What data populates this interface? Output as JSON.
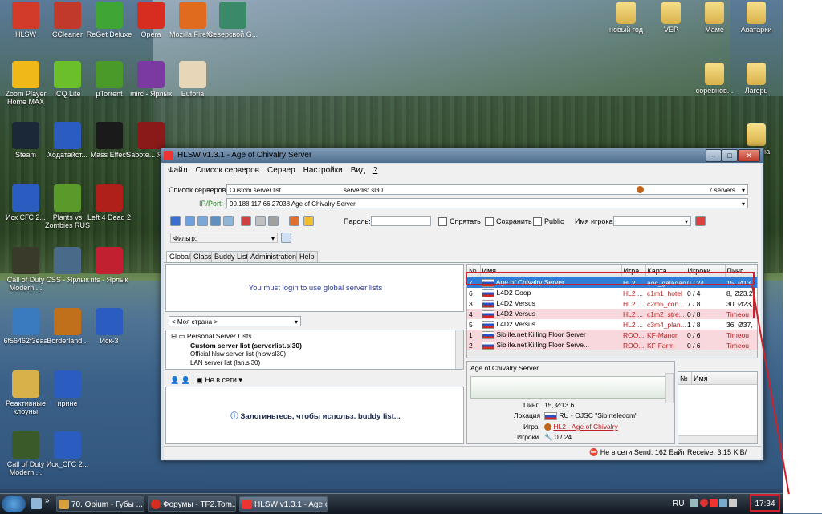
{
  "desktop": {
    "icons": [
      {
        "label": "HLSW",
        "color": "#d23a2a"
      },
      {
        "label": "CCleaner",
        "color": "#c0392b"
      },
      {
        "label": "ReGet Deluxe",
        "color": "#3fa535"
      },
      {
        "label": "Opera",
        "color": "#d62d20"
      },
      {
        "label": "Mozilla Firefox",
        "color": "#e06b1f"
      },
      {
        "label": "Северсвой G...",
        "color": "#3a8a6a"
      },
      {
        "label": "Zoom Player Home MAX",
        "color": "#f0b818"
      },
      {
        "label": "ICQ Lite",
        "color": "#6bbf2a"
      },
      {
        "label": "µTorrent",
        "color": "#4a9a2a"
      },
      {
        "label": "mirc - Ярлык",
        "color": "#7a3aa0"
      },
      {
        "label": "Euforia",
        "color": "#e7d6b8"
      },
      {
        "label": "Steam",
        "color": "#1b2838"
      },
      {
        "label": "Ходатайст...",
        "color": "#2a5dbf"
      },
      {
        "label": "Mass Effect",
        "color": "#1a1a1a"
      },
      {
        "label": "Sabote... Ярлы",
        "color": "#8a1a1a"
      },
      {
        "label": "Иск СГС 2...",
        "color": "#2a5dbf"
      },
      {
        "label": "Plants vs Zombies RUS",
        "color": "#5a9a2a"
      },
      {
        "label": "Left 4 Dead 2",
        "color": "#b0201a"
      },
      {
        "label": "Call of Duty Modern ...",
        "color": "#3a3a2a"
      },
      {
        "label": "CSS - Ярлык",
        "color": "#4a6a8a"
      },
      {
        "label": "nfs - Ярлык",
        "color": "#c02030"
      },
      {
        "label": "6f56462f3eaa",
        "color": "#3a7abf"
      },
      {
        "label": "Borderland...",
        "color": "#c0701a"
      },
      {
        "label": "Иск-3",
        "color": "#2a5dbf"
      },
      {
        "label": "Реактивные клоуны",
        "color": "#d8b14a"
      },
      {
        "label": "ирине",
        "color": "#2a5dbf"
      },
      {
        "label": "Call of Duty Modern ...",
        "color": "#3a5a2a"
      },
      {
        "label": "Иск_СГС 2...",
        "color": "#2a5dbf"
      }
    ],
    "right_icons": [
      "новый год",
      "VEP",
      "Маме",
      "Аватарки",
      "соревнов...",
      "Лагерь",
      "Корзина"
    ]
  },
  "window": {
    "title": "HLSW v1.3.1 - Age of Chivalry Server",
    "menu": [
      "Файл",
      "Список серверов",
      "Сервер",
      "Настройки",
      "Вид",
      "?"
    ],
    "serverlist_label": "Список серверов:",
    "serverlist_value": "Custom server list",
    "serverlist_file": "serverlist.sl30",
    "servers_count": "7 servers",
    "ipport_label": "IP/Port:",
    "ipport_value": "90.188.117.66:27038 Age of Chivalry Server",
    "password_label": "Пароль:",
    "hide_label": "Спрятать",
    "save_label": "Сохранить",
    "public_label": "Public",
    "player_label": "Имя игрока:",
    "filter_label": "Фильтр:",
    "tabs": [
      "Global",
      "Classic",
      "Buddy List",
      "Administration",
      "Help"
    ],
    "login_msg": "You must login to use global server lists",
    "country_select": "< Моя страна >",
    "tree": {
      "root": "Personal Server Lists",
      "items": [
        "Custom server list (serverlist.sl30)",
        "Official hlsw server list (hlsw.sl30)",
        "LAN server list (lan.sl30)"
      ]
    },
    "buddy_status": "Не в сети",
    "buddy_msg": "Залогиньтесь, чтобы использ. buddy list...",
    "grid": {
      "columns": [
        "№",
        "Имя",
        "Игра",
        "Карта",
        "Игроки",
        "Пинг"
      ],
      "rows": [
        {
          "n": "7",
          "name": "Age of Chivalry Server",
          "game": "HL2 ...",
          "map": "aoc_galadan",
          "players": "0 / 24",
          "ping": "15, Ø13,",
          "style": "sel"
        },
        {
          "n": "6",
          "name": "L4D2 Coop",
          "game": "HL2 ...",
          "map": "c1m1_hotel",
          "players": "0 / 4",
          "ping": "8, Ø23.2",
          "style": ""
        },
        {
          "n": "3",
          "name": "L4D2 Versus",
          "game": "HL2 ...",
          "map": "c2m5_con...",
          "players": "7 / 8",
          "ping": "30, Ø23,",
          "style": ""
        },
        {
          "n": "4",
          "name": "L4D2 Versus",
          "game": "HL2 ...",
          "map": "c1m2_stre...",
          "players": "0 / 8",
          "ping": "Timeou",
          "style": "pink"
        },
        {
          "n": "5",
          "name": "L4D2 Versus",
          "game": "HL2 ...",
          "map": "c3m4_plan...",
          "players": "1 / 8",
          "ping": "36, Ø37,",
          "style": ""
        },
        {
          "n": "1",
          "name": "Siblife.net Killing Floor Server",
          "game": "ROO...",
          "map": "KF-Manor",
          "players": "0 / 6",
          "ping": "Timeou",
          "style": "pink"
        },
        {
          "n": "2",
          "name": "Siblife.net Killing Floor Serve...",
          "game": "ROO...",
          "map": "KF-Farm",
          "players": "0 / 6",
          "ping": "Timeou",
          "style": "pink"
        }
      ]
    },
    "detail": {
      "title": "Age of Chivalry Server",
      "ping_label": "Пинг",
      "ping_value": "15, Ø13.6",
      "location_label": "Локация",
      "location_value": "RU - OJSC \"Sibirtelecom\"",
      "game_label": "Игра",
      "game_value": "HL2 - Age of Chivalry",
      "players_label": "Игроки",
      "players_value": "0 / 24"
    },
    "players_grid": {
      "columns": [
        "№",
        "Имя"
      ]
    },
    "status": {
      "offline": "Не в сети",
      "send": "Send: 162 Байт",
      "receive": "Receive: 3.15 KiB/"
    }
  },
  "taskbar": {
    "tasks": [
      "70. Opium - Губы ...",
      "Форумы - TF2.Tom...",
      "HLSW v1.3.1 - Age o..."
    ],
    "lang": "RU",
    "clock": "17:34"
  },
  "colors": {
    "selection": "#2f7dd6",
    "highlight_red": "#d0202a"
  }
}
